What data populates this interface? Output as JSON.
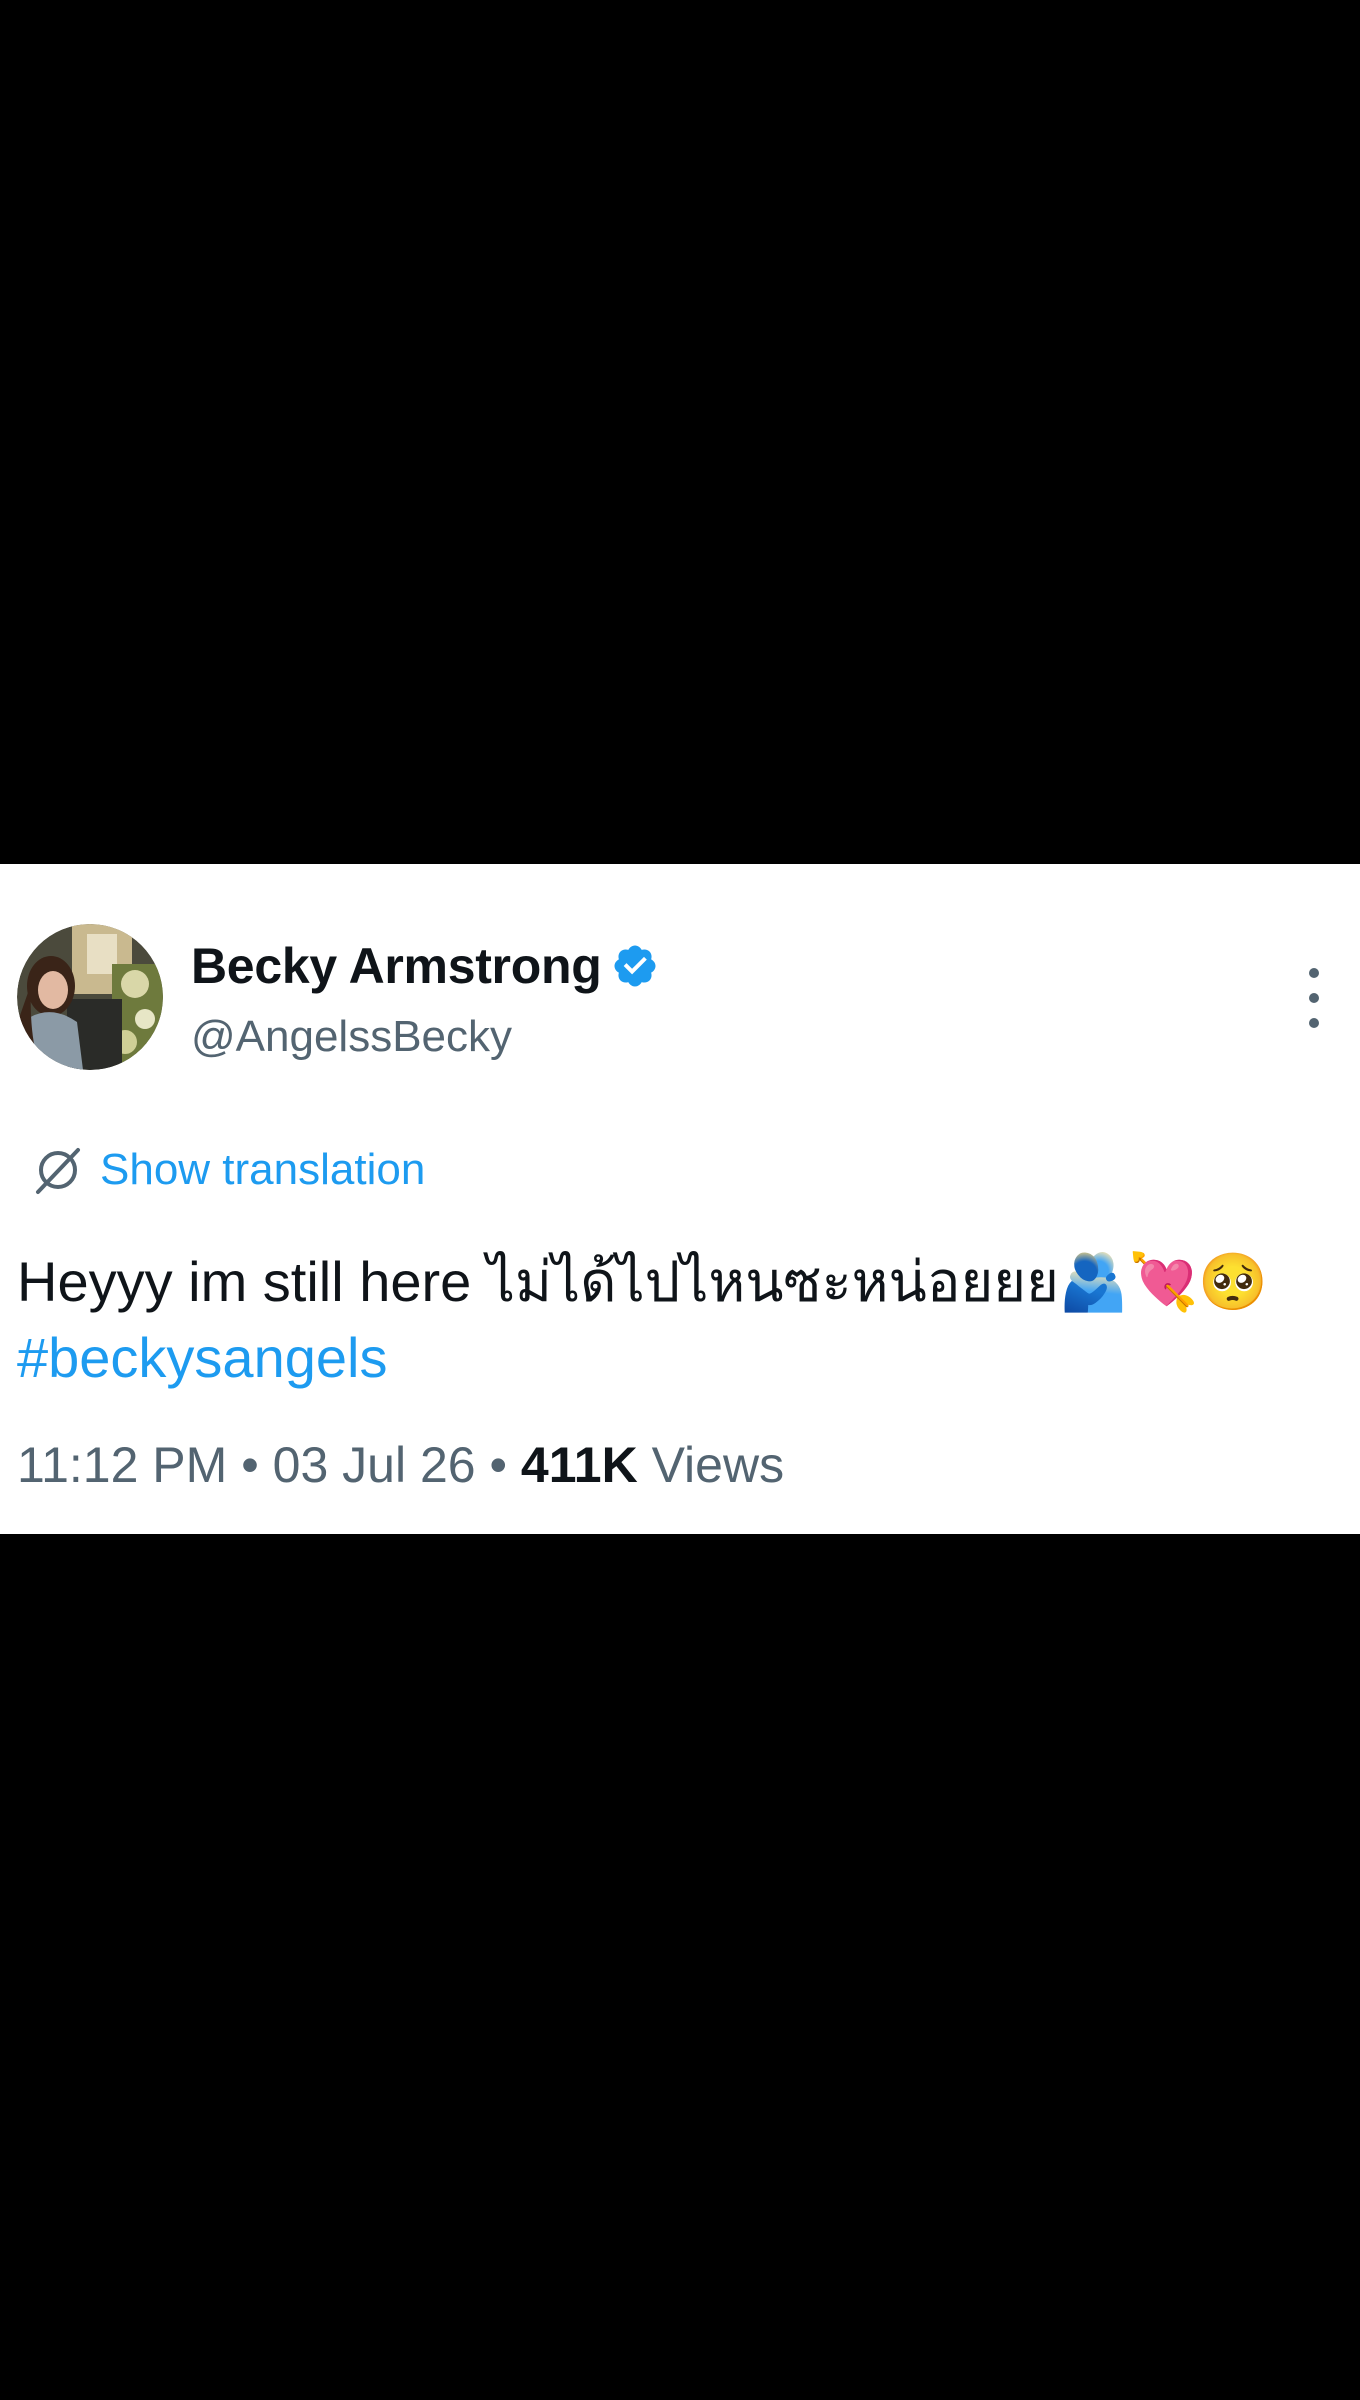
{
  "tweet": {
    "author": {
      "display_name": "Becky Armstrong",
      "handle": "@AngelssBecky",
      "verified": true,
      "avatar_icon": "profile-photo"
    },
    "translation_label": "Show translation",
    "text": "Heyyy im still here ไม่ได้ไปไหนซะหน่อยยย🫂💘🥺",
    "hashtag": "#beckysangels",
    "time": "11:12 PM",
    "separator": "•",
    "date": "03 Jul 26",
    "views_count": "411K",
    "views_label": "Views",
    "more_icon": "more-vertical-icon"
  },
  "colors": {
    "background": "#000000",
    "card": "#ffffff",
    "text_primary": "#0f1419",
    "text_secondary": "#536471",
    "accent": "#1d9bf0"
  }
}
